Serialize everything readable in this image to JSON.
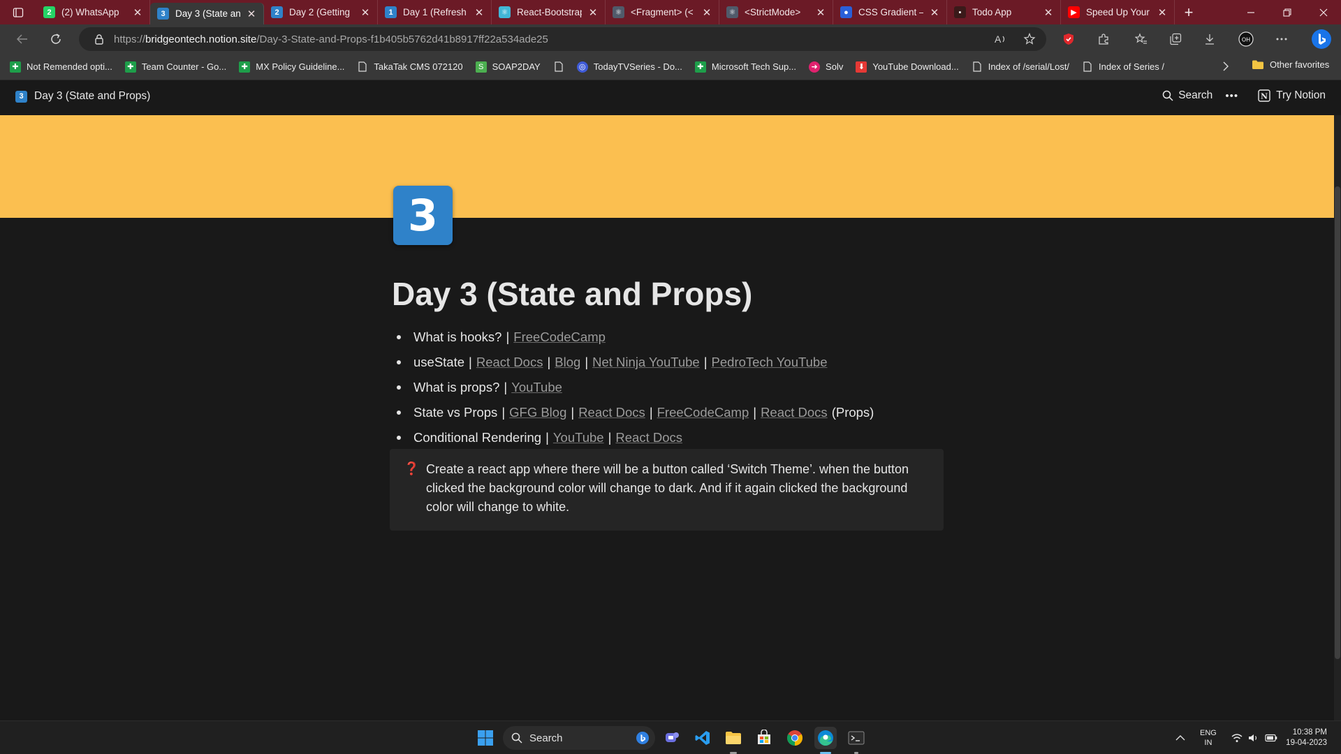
{
  "browser": {
    "tabs": [
      {
        "label": "(2) WhatsApp",
        "icon": "whatsapp-icon",
        "color": "#25d366",
        "glyph": "2"
      },
      {
        "label": "Day 3 (State an",
        "icon": "notion-3-icon",
        "color": "#2f82c9",
        "glyph": "3",
        "active": true
      },
      {
        "label": "Day 2 (Getting",
        "icon": "notion-2-icon",
        "color": "#2f82c9",
        "glyph": "2"
      },
      {
        "label": "Day 1 (Refresh",
        "icon": "notion-1-icon",
        "color": "#2f82c9",
        "glyph": "1"
      },
      {
        "label": "React-Bootstrap",
        "icon": "react-bootstrap-icon",
        "color": "#41b6d6",
        "glyph": "⚛"
      },
      {
        "label": "<Fragment> (<",
        "icon": "react-icon",
        "color": "#505a6a",
        "glyph": "⚛"
      },
      {
        "label": "<StrictMode>",
        "icon": "react-icon",
        "color": "#505a6a",
        "glyph": "⚛"
      },
      {
        "label": "CSS Gradient –",
        "icon": "css-gradient-icon",
        "color": "#2a5fd8",
        "glyph": "●"
      },
      {
        "label": "Todo App",
        "icon": "todo-app-icon",
        "color": "#3a1a1a",
        "glyph": "▪"
      },
      {
        "label": "Speed Up Your",
        "icon": "youtube-icon",
        "color": "#ff0000",
        "glyph": "▶"
      }
    ],
    "url_prefix": "https://",
    "url_host": "bridgeontech.notion.site",
    "url_path": "/Day-3-State-and-Props-f1b405b5762d41b8917ff22a534ade25",
    "bookmarks": [
      {
        "label": "Not Remended opti...",
        "icon": "green-plus-icon",
        "color": "#1e9e4a"
      },
      {
        "label": "Team Counter - Go...",
        "icon": "green-plus-icon",
        "color": "#1e9e4a"
      },
      {
        "label": "MX Policy Guideline...",
        "icon": "green-plus-icon",
        "color": "#1e9e4a"
      },
      {
        "label": "TakaTak CMS 072120",
        "icon": "page-icon",
        "color": ""
      },
      {
        "label": "SOAP2DAY",
        "icon": "soap2day-icon",
        "color": "#4caf50"
      },
      {
        "label": "",
        "icon": "page-icon",
        "color": ""
      },
      {
        "label": "TodayTVSeries - Do...",
        "icon": "globe-icon",
        "color": "#3f5bd8"
      },
      {
        "label": "Microsoft Tech Sup...",
        "icon": "green-plus-icon",
        "color": "#1e9e4a"
      },
      {
        "label": "Solv",
        "icon": "solv-icon",
        "color": "#e0226e"
      },
      {
        "label": "YouTube Download...",
        "icon": "download-icon",
        "color": "#e53935"
      },
      {
        "label": "Index of /serial/Lost/",
        "icon": "page-icon",
        "color": ""
      },
      {
        "label": "Index of Series /",
        "icon": "page-icon",
        "color": ""
      }
    ],
    "other_favorites": "Other favorites"
  },
  "notion": {
    "breadcrumb": "Day 3 (State and Props)",
    "page_icon_glyph": "3",
    "search_label": "Search",
    "more_label": "•••",
    "try_notion": "Try Notion",
    "cover_color": "#fbbf50",
    "title": "Day 3 (State and Props)",
    "items": [
      {
        "parts": [
          {
            "t": "What is hooks?"
          },
          {
            "s": "|"
          },
          {
            "l": "FreeCodeCamp"
          }
        ]
      },
      {
        "parts": [
          {
            "t": "useState"
          },
          {
            "s": "|"
          },
          {
            "l": "React Docs"
          },
          {
            "s": "|"
          },
          {
            "l": "Blog"
          },
          {
            "s": "|"
          },
          {
            "l": "Net Ninja YouTube"
          },
          {
            "s": "|"
          },
          {
            "l": "PedroTech YouTube"
          }
        ]
      },
      {
        "parts": [
          {
            "t": "What is props?"
          },
          {
            "s": "|"
          },
          {
            "l": "YouTube"
          }
        ]
      },
      {
        "parts": [
          {
            "t": "State vs Props"
          },
          {
            "s": "|"
          },
          {
            "l": "GFG Blog"
          },
          {
            "s": "|"
          },
          {
            "l": "React Docs"
          },
          {
            "s": "|"
          },
          {
            "l": "FreeCodeCamp"
          },
          {
            "s": "|"
          },
          {
            "l": "React Docs"
          },
          {
            "t2": "(Props)"
          }
        ]
      },
      {
        "parts": [
          {
            "t": "Conditional Rendering"
          },
          {
            "s": "|"
          },
          {
            "l": "YouTube"
          },
          {
            "s": "|"
          },
          {
            "l": "React Docs"
          }
        ]
      }
    ],
    "callout_icon": "❓",
    "callout_text": "Create a react app where there will be a button called ‘Switch Theme’. when the button clicked the background color will change to dark. And if it again clicked the background color will change to white."
  },
  "taskbar": {
    "search_label": "Search",
    "lang_top": "ENG",
    "lang_bottom": "IN",
    "time": "10:38 PM",
    "date": "19-04-2023"
  }
}
